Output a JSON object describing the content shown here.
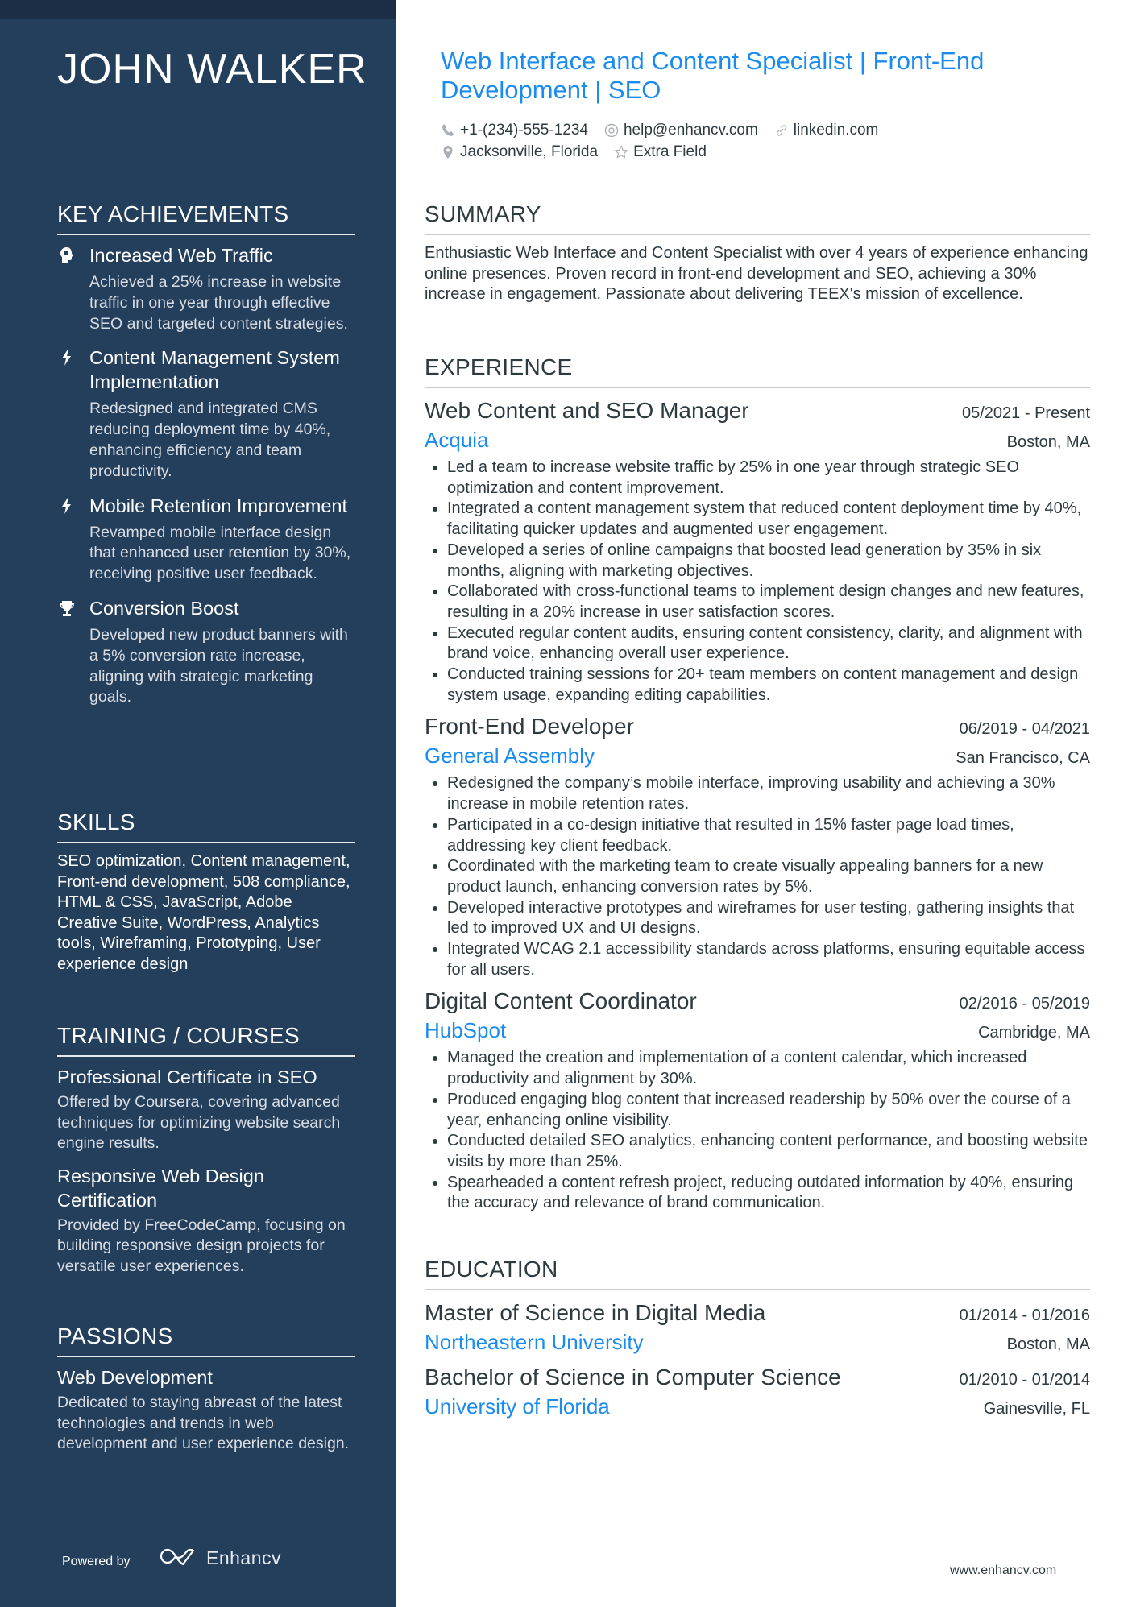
{
  "sidebar": {
    "name": "JOHN WALKER",
    "key_achievements": {
      "heading": "KEY ACHIEVEMENTS",
      "items": [
        {
          "icon": "brain-head-icon",
          "title": "Increased Web Traffic",
          "desc": "Achieved a 25% increase in website traffic in one year through effective SEO and targeted content strategies."
        },
        {
          "icon": "lightning-bolt-icon",
          "title": "Content Management System Implementation",
          "desc": "Redesigned and integrated CMS reducing deployment time by 40%, enhancing efficiency and team productivity."
        },
        {
          "icon": "lightning-bolt-icon",
          "title": "Mobile Retention Improvement",
          "desc": "Revamped mobile interface design that enhanced user retention by 30%, receiving positive user feedback."
        },
        {
          "icon": "trophy-icon",
          "title": "Conversion Boost",
          "desc": "Developed new product banners with a 5% conversion rate increase, aligning with strategic marketing goals."
        }
      ]
    },
    "skills": {
      "heading": "SKILLS",
      "text": "SEO optimization, Content management, Front-end development, 508 compliance, HTML & CSS, JavaScript, Adobe Creative Suite, WordPress, Analytics tools, Wireframing, Prototyping, User experience design"
    },
    "training": {
      "heading": "TRAINING / COURSES",
      "items": [
        {
          "title": "Professional Certificate in SEO",
          "desc": "Offered by Coursera, covering advanced techniques for optimizing website search engine results."
        },
        {
          "title": "Responsive Web Design Certification",
          "desc": "Provided by FreeCodeCamp, focusing on building responsive design projects for versatile user experiences."
        }
      ]
    },
    "passions": {
      "heading": "PASSIONS",
      "items": [
        {
          "title": "Web Development",
          "desc": "Dedicated to staying abreast of the latest technologies and trends in web development and user experience design."
        }
      ]
    },
    "powered_by": "Powered by",
    "brand": "Enhancv"
  },
  "header": {
    "title": "Web Interface and Content Specialist | Front-End Development | SEO",
    "phone": "+1-(234)-555-1234",
    "email": "help@enhancv.com",
    "linkedin": "linkedin.com",
    "location": "Jacksonville, Florida",
    "extra": "Extra Field"
  },
  "summary": {
    "heading": "SUMMARY",
    "text": "Enthusiastic Web Interface and Content Specialist with over 4 years of experience enhancing online presences. Proven record in front-end development and SEO, achieving a 30% increase in engagement. Passionate about delivering TEEX's mission of excellence."
  },
  "experience": {
    "heading": "EXPERIENCE",
    "jobs": [
      {
        "title": "Web Content and SEO Manager",
        "dates": "05/2021 - Present",
        "company": "Acquia",
        "location": "Boston, MA",
        "bullets": [
          "Led a team to increase website traffic by 25% in one year through strategic SEO optimization and content improvement.",
          "Integrated a content management system that reduced content deployment time by 40%, facilitating quicker updates and augmented user engagement.",
          "Developed a series of online campaigns that boosted lead generation by 35% in six months, aligning with marketing objectives.",
          "Collaborated with cross-functional teams to implement design changes and new features, resulting in a 20% increase in user satisfaction scores.",
          "Executed regular content audits, ensuring content consistency, clarity, and alignment with brand voice, enhancing overall user experience.",
          "Conducted training sessions for 20+ team members on content management and design system usage, expanding editing capabilities."
        ]
      },
      {
        "title": "Front-End Developer",
        "dates": "06/2019 - 04/2021",
        "company": "General Assembly",
        "location": "San Francisco, CA",
        "bullets": [
          "Redesigned the company’s mobile interface, improving usability and achieving a 30% increase in mobile retention rates.",
          "Participated in a co-design initiative that resulted in 15% faster page load times, addressing key client feedback.",
          "Coordinated with the marketing team to create visually appealing banners for a new product launch, enhancing conversion rates by 5%.",
          "Developed interactive prototypes and wireframes for user testing, gathering insights that led to improved UX and UI designs.",
          "Integrated WCAG 2.1 accessibility standards across platforms, ensuring equitable access for all users."
        ]
      },
      {
        "title": "Digital Content Coordinator",
        "dates": "02/2016 - 05/2019",
        "company": "HubSpot",
        "location": "Cambridge, MA",
        "bullets": [
          "Managed the creation and implementation of a content calendar, which increased productivity and alignment by 30%.",
          "Produced engaging blog content that increased readership by 50% over the course of a year, enhancing online visibility.",
          "Conducted detailed SEO analytics, enhancing content performance, and boosting website visits by more than 25%.",
          "Spearheaded a content refresh project, reducing outdated information by 40%, ensuring the accuracy and relevance of brand communication."
        ]
      }
    ]
  },
  "education": {
    "heading": "EDUCATION",
    "items": [
      {
        "degree": "Master of Science in Digital Media",
        "dates": "01/2014 - 01/2016",
        "school": "Northeastern University",
        "location": "Boston, MA"
      },
      {
        "degree": "Bachelor of Science in Computer Science",
        "dates": "01/2010 - 01/2014",
        "school": "University of Florida",
        "location": "Gainesville, FL"
      }
    ]
  },
  "footer": {
    "url": "www.enhancv.com"
  },
  "colors": {
    "sidebar": "#243f5c",
    "sidebar_top": "#1c2e45",
    "accent": "#1a8cf0",
    "text": "#2d3a40"
  }
}
